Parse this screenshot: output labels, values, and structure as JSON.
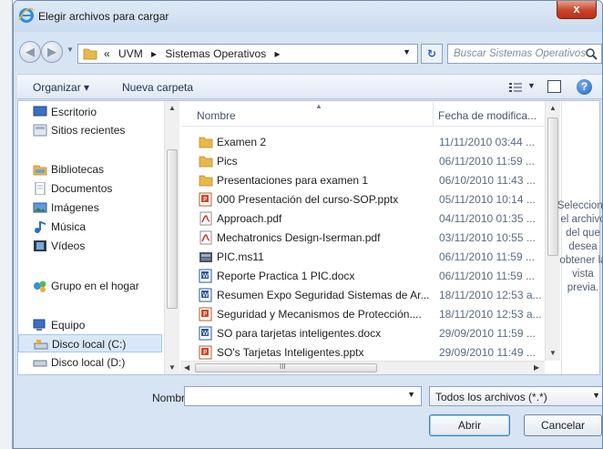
{
  "window": {
    "title": "Elegir archivos para cargar",
    "close_label": "x"
  },
  "nav": {
    "back_glyph": "◀",
    "forward_glyph": "▶",
    "address": [
      "«",
      "UVM",
      "▸",
      "Sistemas Operativos",
      "▸"
    ],
    "search_placeholder": "Buscar Sistemas Operativos"
  },
  "toolbar": {
    "organize_label": "Organizar ▾",
    "new_folder_label": "Nueva carpeta"
  },
  "sidebar": {
    "items": [
      {
        "label": "Escritorio",
        "icon": "desktop-icon"
      },
      {
        "label": "Sitios recientes",
        "icon": "recent-places-icon"
      },
      {
        "label": "Bibliotecas",
        "icon": "libraries-icon"
      },
      {
        "label": "Documentos",
        "icon": "documents-icon"
      },
      {
        "label": "Imágenes",
        "icon": "pictures-icon"
      },
      {
        "label": "Música",
        "icon": "music-icon"
      },
      {
        "label": "Vídeos",
        "icon": "videos-icon"
      },
      {
        "label": "Grupo en el hogar",
        "icon": "homegroup-icon"
      },
      {
        "label": "Equipo",
        "icon": "computer-icon"
      },
      {
        "label": "Disco local (C:)",
        "icon": "drive-icon",
        "selected": true
      },
      {
        "label": "Disco local (D:)",
        "icon": "drive-icon"
      }
    ]
  },
  "filelist": {
    "columns": {
      "name": "Nombre",
      "date": "Fecha de modifica..."
    },
    "files": [
      {
        "name": "Examen 2",
        "date": "11/11/2010 03:44 ...",
        "type": "folder"
      },
      {
        "name": "Pics",
        "date": "06/11/2010 11:59 ...",
        "type": "folder"
      },
      {
        "name": "Presentaciones para examen 1",
        "date": "06/10/2010 11:43 ...",
        "type": "folder"
      },
      {
        "name": "000 Presentación del curso-SOP.pptx",
        "date": "05/11/2010 10:14 ...",
        "type": "pptx"
      },
      {
        "name": "Approach.pdf",
        "date": "04/11/2010 01:35 ...",
        "type": "pdf"
      },
      {
        "name": "Mechatronics Design-Iserman.pdf",
        "date": "03/11/2010 10:55 ...",
        "type": "pdf"
      },
      {
        "name": "PIC.ms11",
        "date": "06/11/2010 11:59 ...",
        "type": "ms11"
      },
      {
        "name": "Reporte Practica 1 PIC.docx",
        "date": "06/11/2010 11:59 ...",
        "type": "docx"
      },
      {
        "name": "Resumen Expo Seguridad Sistemas de Ar...",
        "date": "18/11/2010 12:53 a...",
        "type": "docx"
      },
      {
        "name": "Seguridad y Mecanismos de Protección....",
        "date": "18/11/2010 12:53 a...",
        "type": "pptx"
      },
      {
        "name": "SO para tarjetas inteligentes.docx",
        "date": "29/09/2010 11:59 ...",
        "type": "docx"
      },
      {
        "name": "SO's Tarjetas Inteligentes.pptx",
        "date": "29/09/2010 11:49 ...",
        "type": "pptx"
      }
    ],
    "hscroll_glyph": "III"
  },
  "preview": {
    "text": "Seleccione el archivo del que desea obtener la vista previa."
  },
  "footer": {
    "filename_label": "Nombre:",
    "filename_value": "",
    "filter_value": "Todos los archivos (*.*)",
    "open_label": "Abrir",
    "cancel_label": "Cancelar"
  }
}
